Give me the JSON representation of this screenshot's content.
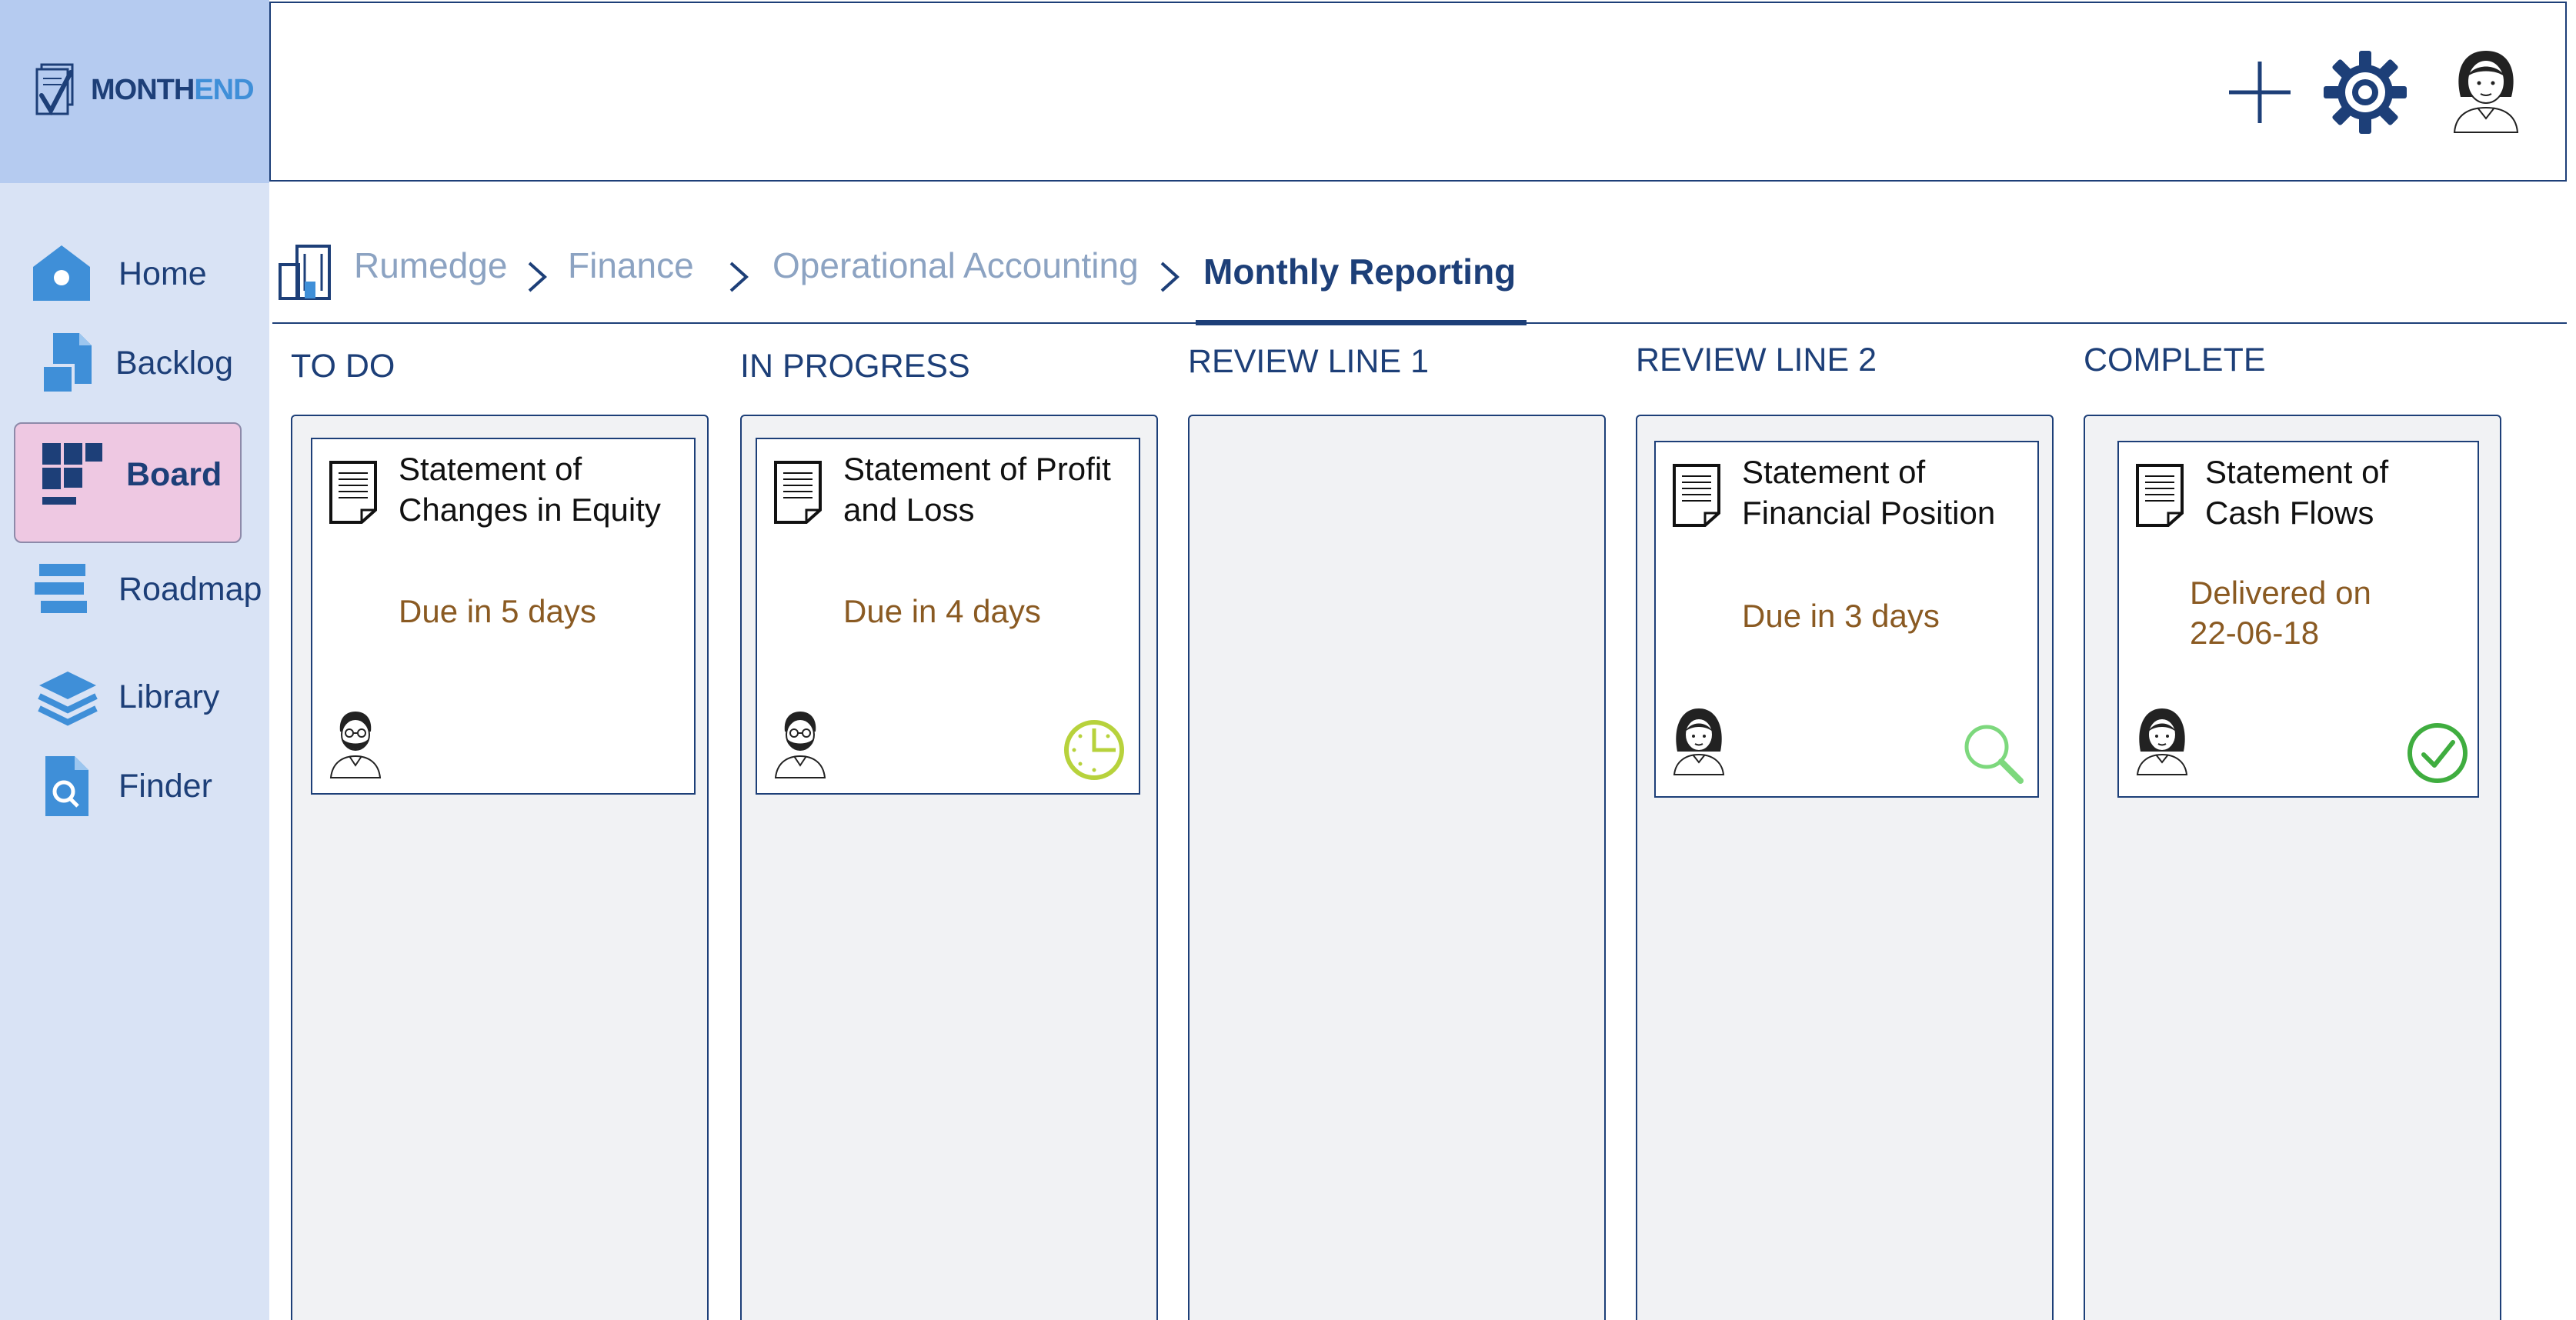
{
  "app": {
    "name_part1": "MONTH",
    "name_part2": "END"
  },
  "sidebar": {
    "items": [
      {
        "label": "Home",
        "icon": "home-icon"
      },
      {
        "label": "Backlog",
        "icon": "backlog-icon"
      },
      {
        "label": "Board",
        "icon": "board-icon",
        "active": true
      },
      {
        "label": "Roadmap",
        "icon": "roadmap-icon"
      },
      {
        "label": "Library",
        "icon": "library-icon"
      },
      {
        "label": "Finder",
        "icon": "finder-icon"
      }
    ]
  },
  "header": {
    "actions": [
      "add-icon",
      "gear-icon",
      "user-avatar"
    ]
  },
  "breadcrumb": {
    "items": [
      "Rumedge",
      "Finance",
      "Operational Accounting",
      "Monthly Reporting"
    ]
  },
  "board": {
    "columns": [
      {
        "title": "TO DO",
        "cards": [
          {
            "title": "Statement of Changes in Equity",
            "status": "Due in 5 days",
            "assignee": "bearded-man-avatar",
            "state_icon": ""
          }
        ]
      },
      {
        "title": "IN PROGRESS",
        "cards": [
          {
            "title": "Statement of Profit and Loss",
            "status": "Due in 4 days",
            "assignee": "bearded-man-avatar",
            "state_icon": "clock-icon"
          }
        ]
      },
      {
        "title": "REVIEW LINE 1",
        "cards": []
      },
      {
        "title": "REVIEW LINE 2",
        "cards": [
          {
            "title": "Statement of Financial Position",
            "status": "Due in 3 days",
            "assignee": "woman-avatar",
            "state_icon": "magnifier-icon"
          }
        ]
      },
      {
        "title": "COMPLETE",
        "cards": [
          {
            "title": "Statement of Cash Flows",
            "status": "Delivered on 22-06-18",
            "assignee": "woman-avatar",
            "state_icon": "check-circle-icon"
          }
        ]
      }
    ]
  },
  "colors": {
    "primary": "#1d3f78",
    "accent_blue": "#3f8fd8",
    "sidebar_bg": "#d9e3f5",
    "logo_bg": "#b5cbf0",
    "active_nav_bg": "#eec8e2",
    "status_text": "#8a5a22",
    "clock_green": "#b7d23c",
    "search_green": "#7dd87d",
    "check_green": "#3fad3f"
  }
}
